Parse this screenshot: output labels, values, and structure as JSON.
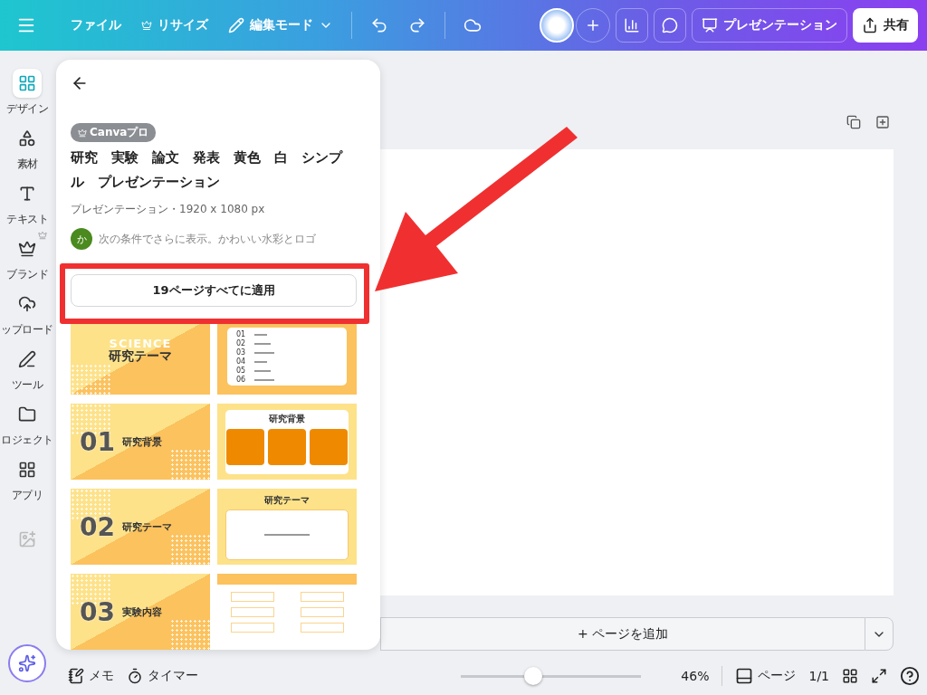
{
  "topbar": {
    "menu": [
      {
        "label": "ファイル",
        "pro": false
      },
      {
        "label": "リサイズ",
        "pro": true
      }
    ],
    "mode": {
      "label": "編集モード"
    },
    "present": {
      "label": "プレゼンテーション"
    },
    "share": {
      "label": "共有"
    }
  },
  "sidebar": {
    "items": [
      {
        "label": "デザイン",
        "selected": true,
        "pro": false
      },
      {
        "label": "素材",
        "selected": false,
        "pro": false
      },
      {
        "label": "テキスト",
        "selected": false,
        "pro": false
      },
      {
        "label": "ブランド",
        "selected": false,
        "pro": true
      },
      {
        "label": "ップロード",
        "selected": false,
        "pro": false
      },
      {
        "label": "ツール",
        "selected": false,
        "pro": false
      },
      {
        "label": "ロジェクト",
        "selected": false,
        "pro": false
      },
      {
        "label": "アプリ",
        "selected": false,
        "pro": false
      }
    ]
  },
  "panel": {
    "badge": "Canvaプロ",
    "title": "研究　実験　論文　発表　黄色　白　シンプル　プレゼンテーション",
    "meta": "プレゼンテーション・1920 x 1080 px",
    "author": {
      "initial": "か",
      "text": "次の条件でさらに表示。かわいい水彩とロゴ"
    },
    "apply_button": "19ページすべてに適用",
    "slides": [
      {
        "kind": "title",
        "watermark": "SCIENCE",
        "heading": "研究テーマ"
      },
      {
        "kind": "agenda",
        "numbers": [
          "01",
          "02",
          "03",
          "04",
          "05",
          "06"
        ]
      },
      {
        "kind": "section",
        "number": "01",
        "heading": "研究背景"
      },
      {
        "kind": "cards",
        "heading": "研究背景"
      },
      {
        "kind": "section",
        "number": "02",
        "heading": "研究テーマ"
      },
      {
        "kind": "topic",
        "heading": "研究テーマ"
      },
      {
        "kind": "section",
        "number": "03",
        "heading": "実験内容"
      },
      {
        "kind": "method"
      }
    ]
  },
  "canvas": {
    "add_page": "+ ページを追加"
  },
  "bottombar": {
    "notes": "メモ",
    "timer": "タイマー",
    "zoom": {
      "level": 0.4,
      "reading": "46%"
    },
    "pages": "ページ",
    "page_count": "1/1"
  }
}
